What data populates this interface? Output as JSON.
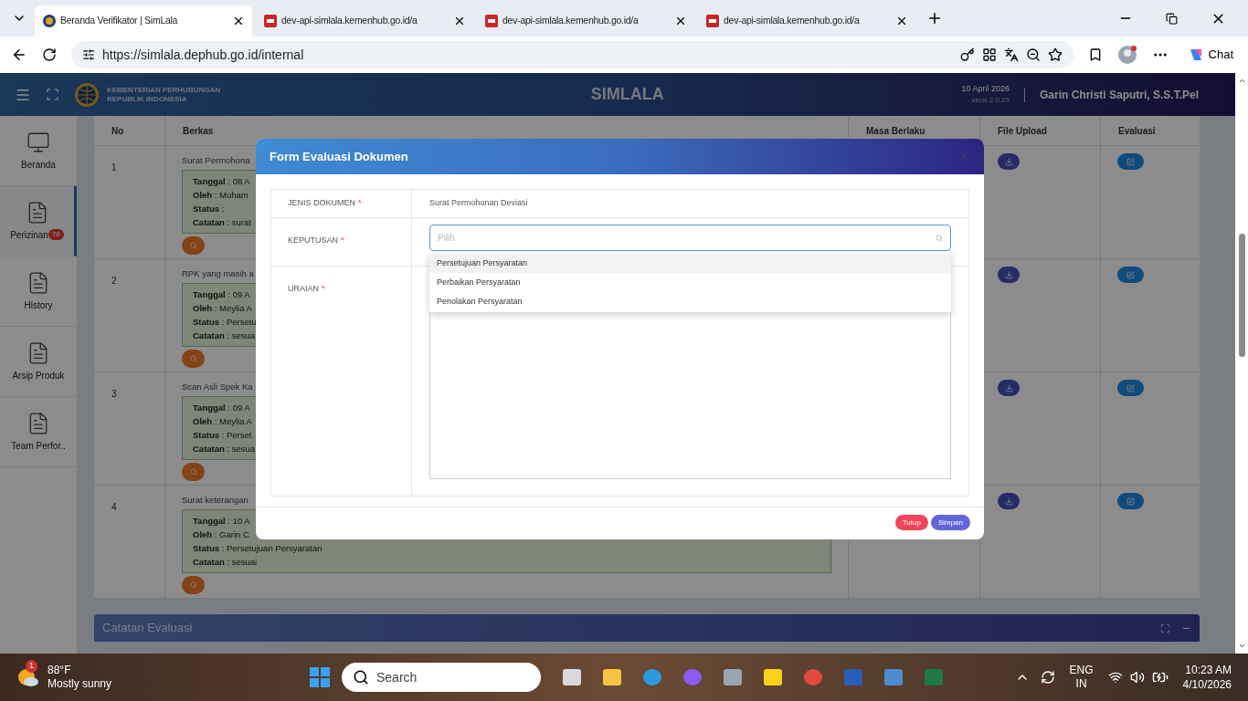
{
  "browser": {
    "tabs": [
      {
        "title": "Beranda Verifikator | SimLala",
        "kind": "site",
        "selected": true
      },
      {
        "title": "dev-api-simlala.kemenhub.go.id/a",
        "kind": "pdf",
        "selected": false
      },
      {
        "title": "dev-api-simlala.kemenhub.go.id/a",
        "kind": "pdf",
        "selected": false
      },
      {
        "title": "dev-api-simlala.kemenhub.go.id/a",
        "kind": "pdf",
        "selected": false
      }
    ],
    "url": "https://simlala.dephub.go.id/internal",
    "chat": "Chat"
  },
  "app": {
    "ministry": [
      "KEMENTERIAN PERHUBUNGAN",
      "REPUBLIK INDONESIA"
    ],
    "title": "SIMLALA",
    "date": "10 April 2026",
    "version": "versi 2.0.23",
    "user": "Garin Christi Saputri, S.S.T.Pel"
  },
  "sidebar": [
    {
      "label": "Beranda",
      "kind": "monitor",
      "selected": false
    },
    {
      "label": "Perizinan",
      "kind": "document",
      "badge": "78",
      "selected": true
    },
    {
      "label": "History",
      "kind": "document",
      "selected": false
    },
    {
      "label": "Arsip Produk",
      "kind": "document",
      "selected": false
    },
    {
      "label": "Team Perfor..",
      "kind": "document",
      "selected": false
    }
  ],
  "table": {
    "columns": [
      "No",
      "Berkas",
      "Masa Berlaku",
      "File Upload",
      "Evaluasi"
    ],
    "rows": [
      {
        "no": "1",
        "title": "Surat Permohona",
        "details": [
          "**Tanggal** : 08 A",
          "**Oleh** : Muham",
          "**Status** :",
          "**Catatan** : surat"
        ]
      },
      {
        "no": "2",
        "title": "RPK yang masih a",
        "details": [
          "**Tanggal** : 09 A",
          "**Oleh** : Meylia A",
          "**Status** : Persetu",
          "**Catatan** : sesua"
        ]
      },
      {
        "no": "3",
        "title": "Scan Asli Spek Ka",
        "details": [
          "**Tanggal** : 09 A",
          "**Oleh** : Meylia A",
          "**Status** : Perset",
          "**Catatan** : sesua"
        ]
      },
      {
        "no": "4",
        "title": "Surat keterangan",
        "details": [
          "**Tanggal** : 10 A",
          "**Oleh** : Garin C",
          "**Status** : Persetujuan Persyaratan",
          "**Catatan** : sesuai"
        ]
      }
    ]
  },
  "panel": {
    "title": "Catatan Evaluasi"
  },
  "modal": {
    "title": "Form Evaluasi Dokumen",
    "fields": [
      {
        "label": "JENIS DOKUMEN",
        "required_mark": "*",
        "kind": "text",
        "value": "Surat Permohonan Deviasi"
      },
      {
        "label": "KEPUTUSAN",
        "required_mark": "*",
        "kind": "select",
        "placeholder": "Pilih",
        "options": [
          {
            "label": "Persetujuan Persyaratan",
            "highlighted": true
          },
          {
            "label": "Perbaikan Persyaratan",
            "highlighted": false
          },
          {
            "label": "Penolakan Persyaratan",
            "highlighted": false
          }
        ]
      },
      {
        "label": "URAIAN",
        "required_mark": "*",
        "kind": "textarea"
      }
    ],
    "buttons": [
      {
        "label": "Tutup",
        "kind": "close"
      },
      {
        "label": "Simpan",
        "kind": "save"
      }
    ]
  },
  "taskbar": {
    "weather": {
      "temp": "88°F",
      "condition": "Mostly sunny",
      "badge": "1"
    },
    "search": "Search",
    "language": [
      "ENG",
      "IN"
    ],
    "time": "10:23 AM",
    "date": "4/10/2026"
  }
}
